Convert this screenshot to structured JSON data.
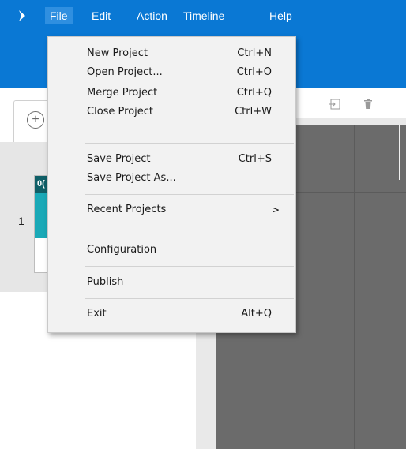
{
  "app": {
    "menus": [
      "File",
      "Edit",
      "Action",
      "Timeline",
      "Help"
    ]
  },
  "file_menu": {
    "items": [
      {
        "label": "New Project",
        "shortcut": "Ctrl+N"
      },
      {
        "label": "Open Project...",
        "shortcut": "Ctrl+O"
      },
      {
        "label": "Merge Project",
        "shortcut": "Ctrl+Q"
      },
      {
        "label": "Close Project",
        "shortcut": "Ctrl+W"
      },
      {
        "label": "Save Project",
        "shortcut": "Ctrl+S"
      },
      {
        "label": "Save Project As...",
        "shortcut": ""
      },
      {
        "label": "Recent Projects",
        "shortcut": ""
      },
      {
        "label": "Configuration",
        "shortcut": ""
      },
      {
        "label": "Publish",
        "shortcut": ""
      },
      {
        "label": "Exit",
        "shortcut": "Alt+Q"
      }
    ],
    "submenu_arrow": ">"
  },
  "toolbar": {
    "add_symbol": "+",
    "import_icon": "import-icon",
    "delete_icon": "trash-icon"
  },
  "timeline": {
    "row_number": "1",
    "thumb_text": "0("
  },
  "colors": {
    "header": "#0a78d4",
    "menu_active": "#2f8fe0",
    "canvas": "#6b6b6b",
    "thumb_dark": "#0f5f67",
    "thumb_teal": "#1aa9b7"
  }
}
